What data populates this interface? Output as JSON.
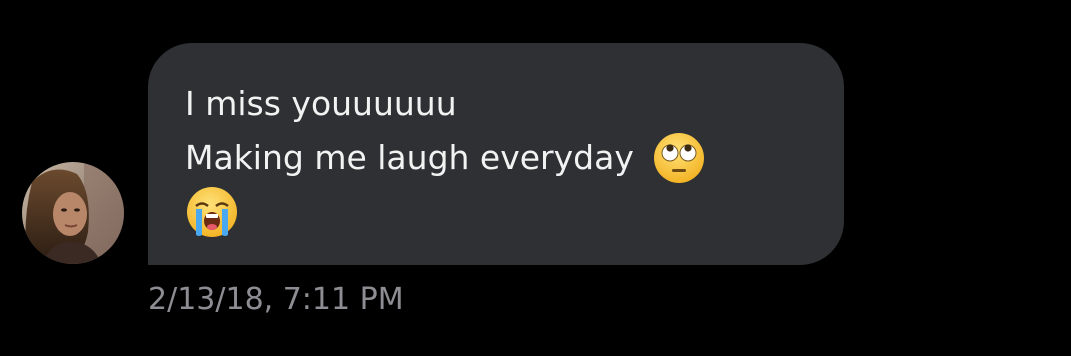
{
  "conversation": {
    "message": {
      "lines": [
        "I miss youuuuuu",
        "Making me laugh everyday"
      ],
      "emojis": [
        "face-with-rolling-eyes-icon",
        "loudly-crying-face-icon"
      ],
      "timestamp": "2/13/18, 7:11 PM"
    },
    "colors": {
      "background": "#000000",
      "bubble": "#2e3033",
      "text": "#f2f2f2",
      "timestamp": "#8d8d93"
    }
  }
}
